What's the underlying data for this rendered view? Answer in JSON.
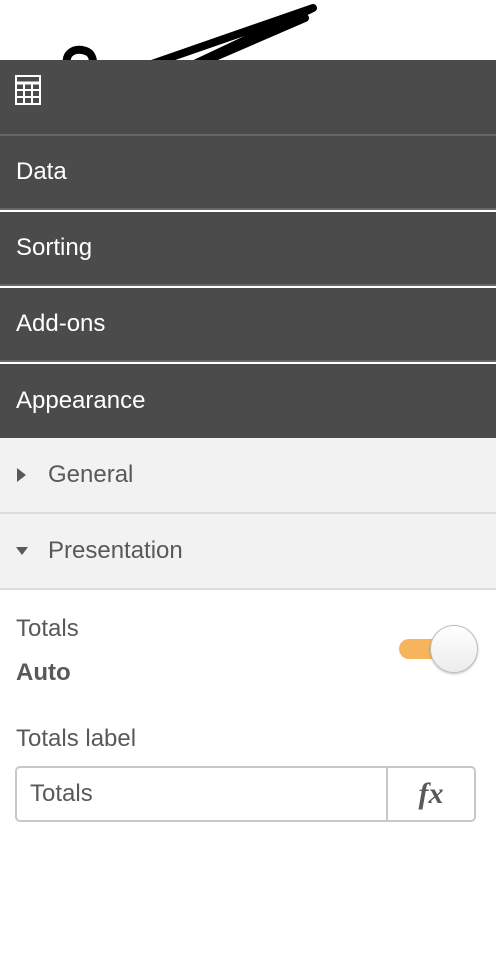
{
  "sections": [
    {
      "label": "Data"
    },
    {
      "label": "Sorting"
    },
    {
      "label": "Add-ons"
    },
    {
      "label": "Appearance"
    }
  ],
  "appearance": {
    "general_label": "General",
    "presentation_label": "Presentation"
  },
  "totals": {
    "label": "Totals",
    "value": "Auto",
    "toggle_on": true
  },
  "totals_label_field": {
    "label": "Totals label",
    "value": "Totals",
    "fx_label": "fx"
  },
  "colors": {
    "panel_dark": "#4b4b4b",
    "accent": "#f6b45c",
    "light_bg": "#f2f2f2",
    "text": "#595959"
  },
  "icons": [
    "table-icon",
    "caret-right-icon",
    "caret-down-icon",
    "fx-icon"
  ]
}
